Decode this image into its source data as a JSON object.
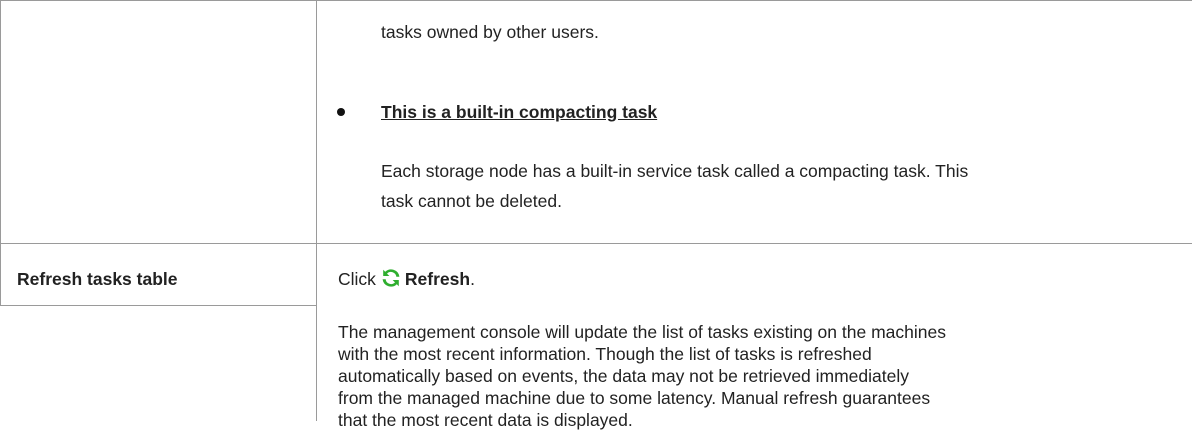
{
  "section_top": {
    "continued_text": "tasks owned by other users.",
    "builtin_heading": "This is a built-in compacting task",
    "builtin_para_line1": "Each storage node has a built-in service task called a compacting task. This",
    "builtin_para_line2": "task cannot be deleted."
  },
  "row_refresh": {
    "label": "Refresh tasks table",
    "click_prefix": "Click",
    "refresh_label": "Refresh",
    "click_suffix": ".",
    "description_lines": [
      "The management console will update the list of tasks existing on the machines",
      "with the most recent information. Though the list of tasks is refreshed",
      "automatically based on events, the data may not be retrieved immediately",
      "from the managed machine due to some latency. Manual refresh guarantees",
      "that the most recent data is displayed."
    ]
  },
  "icons": {
    "refresh": "refresh-icon",
    "bullet": "bullet-icon"
  },
  "colors": {
    "refresh_icon": "#2fae2f",
    "border": "#9a9a9a",
    "text": "#222222"
  }
}
